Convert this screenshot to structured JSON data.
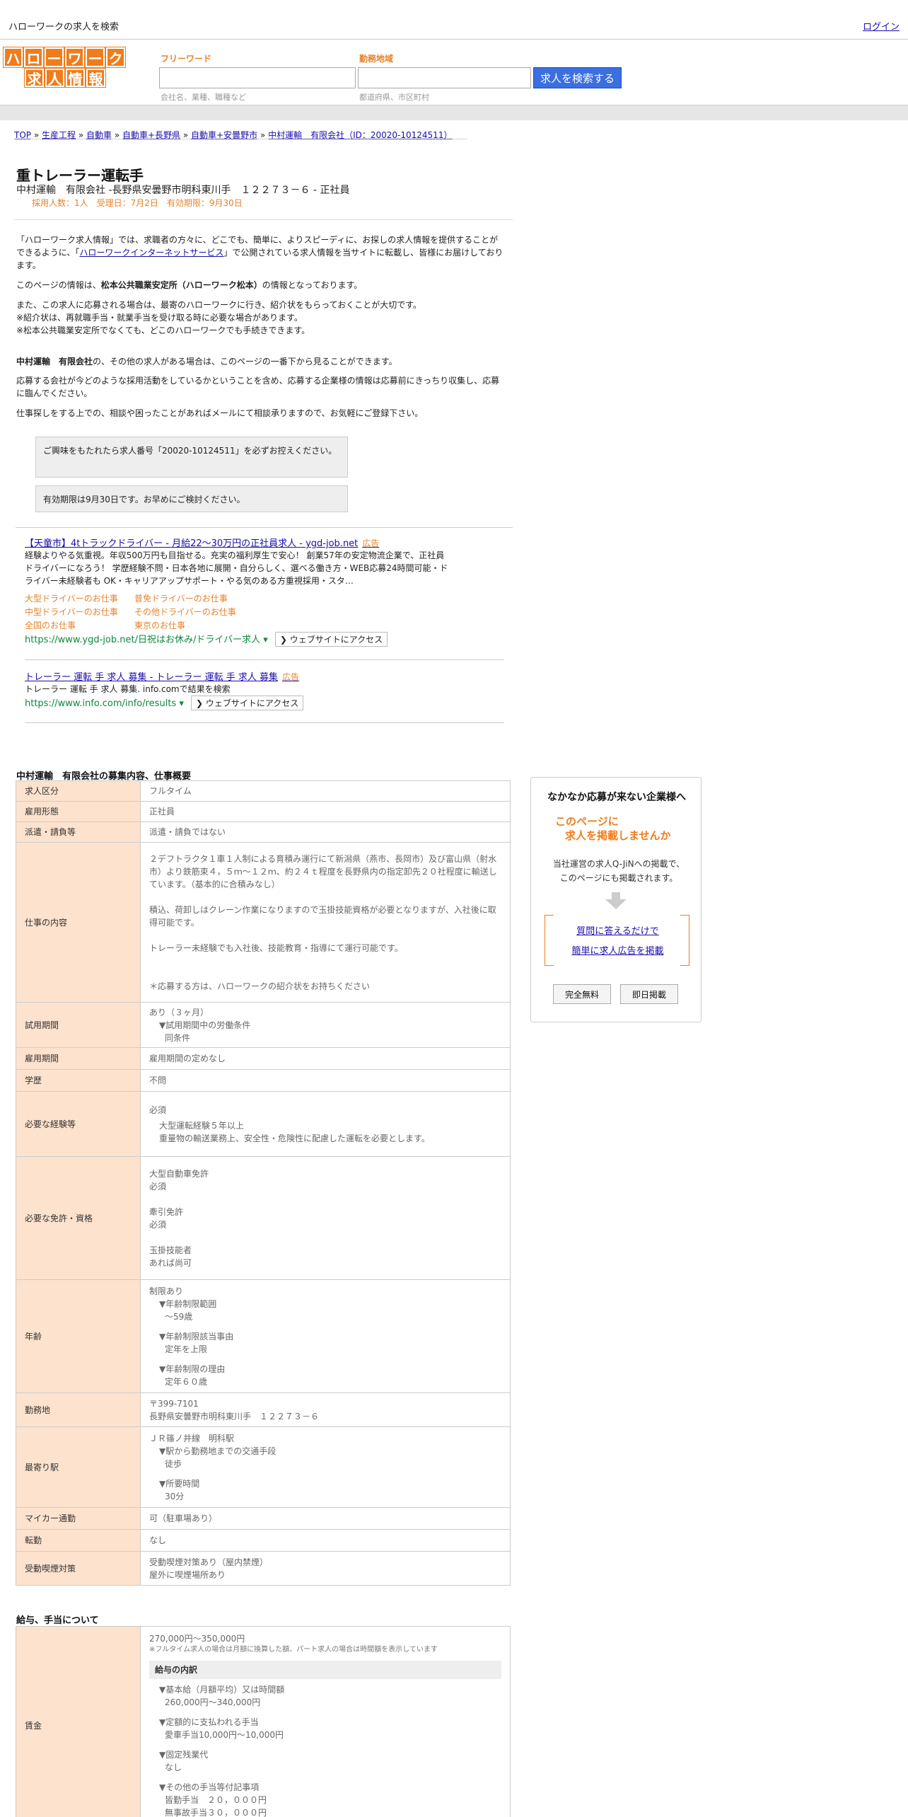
{
  "topbar": {
    "title": "ハローワークの求人を検索",
    "login": "ログイン"
  },
  "logo": {
    "row1": [
      "ハ",
      "ロ",
      "ー",
      "ワ",
      "ー",
      "ク"
    ],
    "row2": [
      "求",
      "人",
      "情",
      "報"
    ]
  },
  "search": {
    "keyword_label": "フリーワード",
    "keyword_hint": "会社名、業種、職種など",
    "area_label": "勤務地域",
    "area_hint": "都道府県、市区町村",
    "button": "求人を検索する"
  },
  "breadcrumb": [
    "TOP",
    "生産工程",
    "自動車",
    "自動車+長野県",
    "自動車+安曇野市",
    "中村運輸　有限会社（ID：20020-10124511）"
  ],
  "job": {
    "title": "重トレーラー運転手",
    "subtitle": "中村運輸　有限会社 -長野県安曇野市明科東川手　１２２７３－６ - 正社員",
    "meta": "採用人数：1人　受理日：7月2日　有効期限：9月30日"
  },
  "intro": {
    "p1a": "「ハローワーク求人情報」では、求職者の方々に、どこでも、簡単に、よりスピーディに、お探しの求人情報を提供することができるように、「",
    "p1link": "ハローワークインターネットサービス",
    "p1b": "」で公開されている求人情報を当サイトに転載し、皆様にお届けしております。",
    "p2a": "このページの情報は、",
    "p2b": "松本公共職業安定所（ハローワーク松本）",
    "p2c": "の情報となっております。",
    "p3": [
      "また、この求人に応募される場合は、最寄のハローワークに行き、紹介状をもらっておくことが大切です。",
      "※紹介状は、再就職手当・就業手当を受け取る時に必要な場合があります。",
      "※松本公共職業安定所でなくても、どこのハローワークでも手続きできます。"
    ],
    "p4a": "中村運輸　有限会社",
    "p4b": "の、その他の求人がある場合は、このページの一番下から見ることができます。",
    "p5": "応募する会社が今どのような採用活動をしているかということを含め、応募する企業様の情報は応募前にきっちり収集し、応募に臨んでください。",
    "p6": "仕事探しをする上での、相談や困ったことがあればメールにて相談承りますので、お気軽にご登録下さい。"
  },
  "notes": {
    "n1": "ご興味をもたれたら求人番号「20020-10124511」を必ずお控えください。",
    "n2": "有効期限は9月30日です。お早めにご検討ください。"
  },
  "ads": [
    {
      "title": "【天童市】4tトラックドライバー - 月給22～30万円の正社員求人 - ygd-job.net",
      "tag": "広告",
      "text": "経験よりやる気重視。年収500万円も目指せる。充実の福利厚生で安心！ 創業57年の安定物流企業で、正社員ドライバーになろう！ 学歴経験不問・日本各地に展開・自分らしく、選べる働き方・WEB応募24時間可能・ドライバー未経験者も OK・キャリアアップサポート・やる気のある方重視採用・スタ…",
      "links": [
        "大型ドライバーのお仕事",
        "普免ドライバーのお仕事",
        "中型ドライバーのお仕事",
        "その他ドライバーのお仕事",
        "全国のお仕事",
        "東京のお仕事"
      ],
      "url": "https://www.ygd-job.net/日祝はお休み/ドライバー求人",
      "button": "ウェブサイトにアクセス"
    },
    {
      "title": "トレーラー 運転 手 求人 募集 - トレーラー 運転 手 求人 募集",
      "tag": "広告",
      "text": "トレーラー 運転 手 求人 募集. info.comで結果を検索",
      "url": "https://www.info.com/info/results",
      "button": "ウェブサイトにアクセス"
    }
  ],
  "details": {
    "heading": "中村運輸　有限会社の募集内容、仕事概要",
    "rows": {
      "r1k": "求人区分",
      "r1v": "フルタイム",
      "r2k": "雇用形態",
      "r2v": "正社員",
      "r3k": "派遣・請負等",
      "r3v": "派遣・請負ではない",
      "r4k": "仕事の内容",
      "r4v1": "２デフトラクタ１車１人制による育積み運行にて新潟県（燕市、長岡市）及び富山県（射水市）より鉄筋束４，５ｍ～１２ｍ、約２４ｔ程度を長野県内の指定卸先２０社程度に輸送しています。（基本的に合積みなし）",
      "r4v2": "積込、荷卸しはクレーン作業になりますので玉掛技能資格が必要となりますが、入社後に取得可能です。",
      "r4v3": "トレーラー未経験でも入社後、技能教育・指導にて運行可能です。",
      "r4v4": "＊応募する方は、ハローワークの紹介状をお持ちください",
      "r5k": "試用期間",
      "r5v1": "あり（３ヶ月）",
      "r5v2": "▼試用期間中の労働条件",
      "r5v3": "同条件",
      "r6k": "雇用期間",
      "r6v": "雇用期間の定めなし",
      "r7k": "学歴",
      "r7v": "不問",
      "r8k": "必要な経験等",
      "r8v1": "必須",
      "r8v2": "大型運転経験５年以上",
      "r8v3": "重量物の輸送業務上、安全性・危険性に配慮した運転を必要とします。",
      "r9k": "必要な免許・資格",
      "r9v1": "大型自動車免許",
      "r9v2": "必須",
      "r9v3": "牽引免許",
      "r9v4": "必須",
      "r9v5": "玉掛技能者",
      "r9v6": "あれば尚可",
      "r10k": "年齢",
      "r10v1": "制限あり",
      "r10v2": "▼年齢制限範囲",
      "r10v3": "～59歳",
      "r10v4": "▼年齢制限該当事由",
      "r10v5": "定年を上限",
      "r10v6": "▼年齢制限の理由",
      "r10v7": "定年６０歳",
      "r11k": "勤務地",
      "r11v1": "〒399-7101",
      "r11v2": "長野県安曇野市明科東川手　１２２７３－６",
      "r12k": "最寄り駅",
      "r12v1": "ＪＲ篠ノ井線　明科駅",
      "r12v2": "▼駅から勤務地までの交通手段",
      "r12v3": "徒歩",
      "r12v4": "▼所要時間",
      "r12v5": "30分",
      "r13k": "マイカー通勤",
      "r13v": "可（駐車場あり）",
      "r14k": "転勤",
      "r14v": "なし",
      "r15k": "受動喫煙対策",
      "r15v1": "受動喫煙対策あり（屋内禁煙）",
      "r15v2": "屋外に喫煙場所あり"
    }
  },
  "salary": {
    "heading": "給与、手当について",
    "key": "賃金",
    "range": "270,000円〜350,000円",
    "note": "※フルタイム求人の場合は月額に換算した額、パート求人の場合は時間額を表示しています",
    "subhead": "給与の内訳",
    "b1": "▼基本給（月額平均）又は時間額",
    "b1v": "260,000円〜340,000円",
    "b2": "▼定額的に支払われる手当",
    "b2v": "愛車手当10,000円〜10,000円",
    "b3": "▼固定残業代",
    "b3v": "なし",
    "b4": "▼その他の手当等付記事項",
    "b4v1": "皆勤手当　２０，０００円",
    "b4v2": "無事故手当３０，０００円"
  },
  "side": {
    "heading": "なかなか応募が来ない企業様へ",
    "orange1": "このページに",
    "orange2": "求人を掲載しませんか",
    "text1": "当社運営の求人Q-JiNへの掲載で、",
    "text2": "このページにも掲載されます。",
    "link1": "質問に答えるだけで",
    "link2": "簡単に求人広告を掲載",
    "btn1": "完全無料",
    "btn2": "即日掲載"
  },
  "colors": {
    "accent": "#f07c1c",
    "button_blue": "#3b6ee0",
    "key_bg": "#fde2cd",
    "link": "#1a0dab"
  }
}
